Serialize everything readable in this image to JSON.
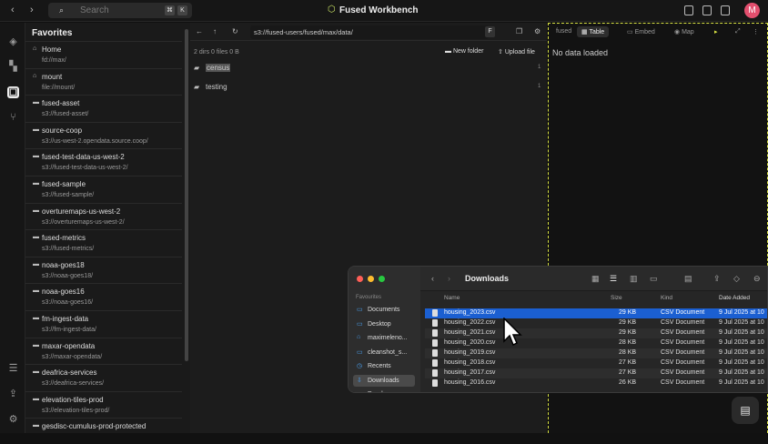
{
  "app": {
    "title": "Fused Workbench"
  },
  "topbar": {
    "search_placeholder": "Search",
    "kbd1": "⌘",
    "kbd2": "K",
    "avatar_initial": "M"
  },
  "favorites": {
    "title": "Favorites",
    "items": [
      {
        "name": "Home",
        "path": "fd://max/",
        "icon": "home-icon"
      },
      {
        "name": "mount",
        "path": "file://mount/",
        "icon": "home-icon"
      },
      {
        "name": "fused-asset",
        "path": "s3://fused-asset/",
        "icon": "bucket-icon"
      },
      {
        "name": "source-coop",
        "path": "s3://us-west-2.opendata.source.coop/",
        "icon": "bucket-icon"
      },
      {
        "name": "fused-test-data-us-west-2",
        "path": "s3://fused-test-data-us-west-2/",
        "icon": "bucket-icon"
      },
      {
        "name": "fused-sample",
        "path": "s3://fused-sample/",
        "icon": "bucket-icon"
      },
      {
        "name": "overturemaps-us-west-2",
        "path": "s3://overturemaps-us-west-2/",
        "icon": "bucket-icon"
      },
      {
        "name": "fused-metrics",
        "path": "s3://fused-metrics/",
        "icon": "bucket-icon"
      },
      {
        "name": "noaa-goes18",
        "path": "s3://noaa-goes18/",
        "icon": "bucket-icon"
      },
      {
        "name": "noaa-goes16",
        "path": "s3://noaa-goes16/",
        "icon": "bucket-icon"
      },
      {
        "name": "fm-ingest-data",
        "path": "s3://fm-ingest-data/",
        "icon": "bucket-icon"
      },
      {
        "name": "maxar-opendata",
        "path": "s3://maxar-opendata/",
        "icon": "bucket-icon"
      },
      {
        "name": "deafrica-services",
        "path": "s3://deafrica-services/",
        "icon": "bucket-icon"
      },
      {
        "name": "elevation-tiles-prod",
        "path": "s3://elevation-tiles-prod/",
        "icon": "bucket-icon"
      },
      {
        "name": "gesdisc-cumulus-prod-protected",
        "path": "",
        "icon": "bucket-icon"
      }
    ]
  },
  "browser": {
    "path": "s3://fused-users/fused/max/data/",
    "kbd": "F",
    "stats": "2 dirs 0 files 0 B",
    "new_folder": "New folder",
    "upload_file": "Upload file",
    "rows": [
      {
        "name": "census",
        "count": "1"
      },
      {
        "name": "testing",
        "count": "1"
      }
    ]
  },
  "data_panel": {
    "source": "fused",
    "tabs": [
      "Table",
      "Embed",
      "Map"
    ],
    "active_tab": "Table",
    "empty_text": "No data loaded"
  },
  "finder": {
    "title": "Downloads",
    "sidebar_heading": "Favourites",
    "sidebar_items": [
      "Documents",
      "Desktop",
      "maximeleno...",
      "cleanshot_s...",
      "Recents",
      "Downloads",
      "Dropbox"
    ],
    "active_item": "Downloads",
    "columns": {
      "name": "Name",
      "size": "Size",
      "kind": "Kind",
      "date": "Date Added"
    },
    "files": [
      {
        "name": "housing_2023.csv",
        "size": "29 KB",
        "kind": "CSV Document",
        "date": "9 Jul 2025 at 10"
      },
      {
        "name": "housing_2022.csv",
        "size": "29 KB",
        "kind": "CSV Document",
        "date": "9 Jul 2025 at 10"
      },
      {
        "name": "housing_2021.csv",
        "size": "29 KB",
        "kind": "CSV Document",
        "date": "9 Jul 2025 at 10"
      },
      {
        "name": "housing_2020.csv",
        "size": "28 KB",
        "kind": "CSV Document",
        "date": "9 Jul 2025 at 10"
      },
      {
        "name": "housing_2019.csv",
        "size": "28 KB",
        "kind": "CSV Document",
        "date": "9 Jul 2025 at 10"
      },
      {
        "name": "housing_2018.csv",
        "size": "27 KB",
        "kind": "CSV Document",
        "date": "9 Jul 2025 at 10"
      },
      {
        "name": "housing_2017.csv",
        "size": "27 KB",
        "kind": "CSV Document",
        "date": "9 Jul 2025 at 10"
      },
      {
        "name": "housing_2016.csv",
        "size": "26 KB",
        "kind": "CSV Document",
        "date": "9 Jul 2025 at 10"
      }
    ],
    "selected_file": "housing_2023.csv"
  },
  "colors": {
    "accent": "#d9e344",
    "selection": "#1b5fd1",
    "avatar": "#e34f6e"
  }
}
